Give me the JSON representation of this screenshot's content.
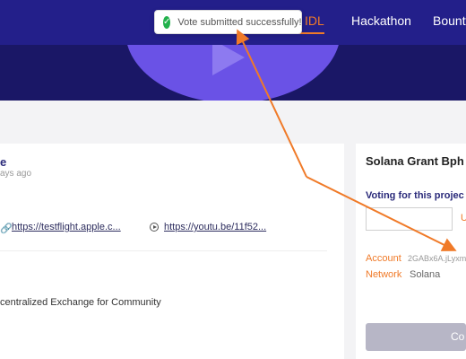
{
  "nav": {
    "active_label": "IDL",
    "hackathon_label": "Hackathon",
    "bounty_label": "Bounty"
  },
  "toast": {
    "message": "Vote submitted successfully!",
    "icon": "check-circle-icon"
  },
  "project": {
    "title_fragment": "e",
    "time_fragment": "ays ago",
    "testflight_link": "https://testflight.apple.c...",
    "youtube_link": "https://youtu.be/11f52...",
    "description_fragment": "centralized Exchange for Community"
  },
  "grant": {
    "title": "Solana Grant Bph",
    "voting_label": "Voting for this projec",
    "amount_value": "",
    "unit_fragment": "U",
    "account_label": "Account",
    "account_value": "2GABx6A.jLyxm",
    "network_label": "Network",
    "network_value": "Solana",
    "confirm_label": "Co"
  },
  "colors": {
    "header": "#231f8a",
    "accent": "#f07a28",
    "success": "#22b14c"
  }
}
